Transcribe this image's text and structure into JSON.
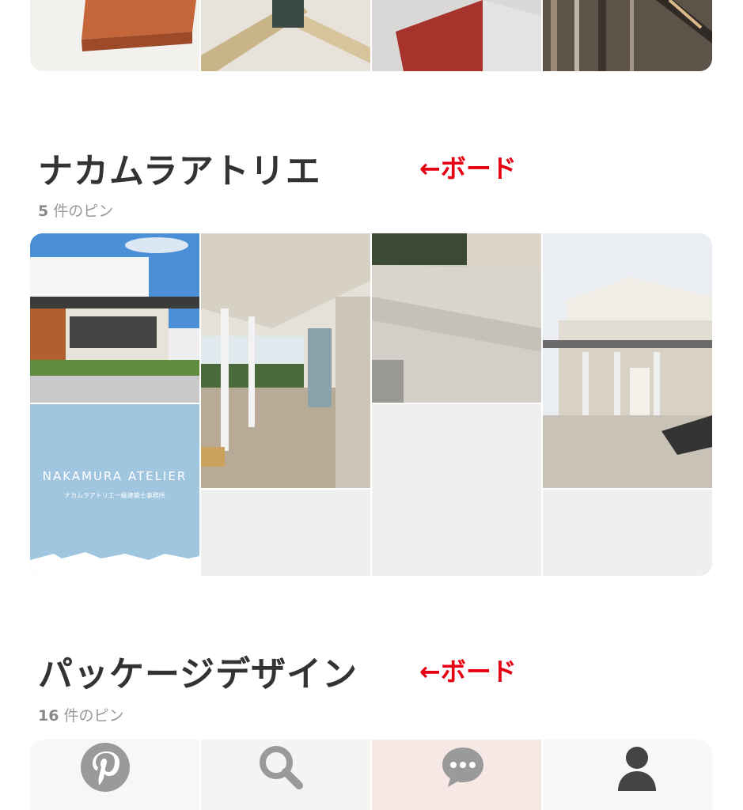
{
  "boards": [
    {
      "title": "ナカムラアトリエ",
      "pin_count": "5",
      "pin_suffix": "件のピン",
      "annotation": "←ボード"
    },
    {
      "title": "パッケージデザイン",
      "pin_count": "16",
      "pin_suffix": "件のピン",
      "annotation": "←ボード"
    }
  ],
  "logo_tile": {
    "name": "NAKAMURA ATELIER",
    "subtitle": "ナカムラアトリエ一級建築士事務所"
  },
  "nav": [
    "home-icon",
    "search-icon",
    "chat-icon",
    "profile-icon"
  ],
  "colors": {
    "annotation": "#e60012",
    "nav_inactive": "#9a9a9a",
    "nav_active": "#444444",
    "placeholder": "#efefef",
    "logo_tile_bg": "#9fc5df"
  }
}
